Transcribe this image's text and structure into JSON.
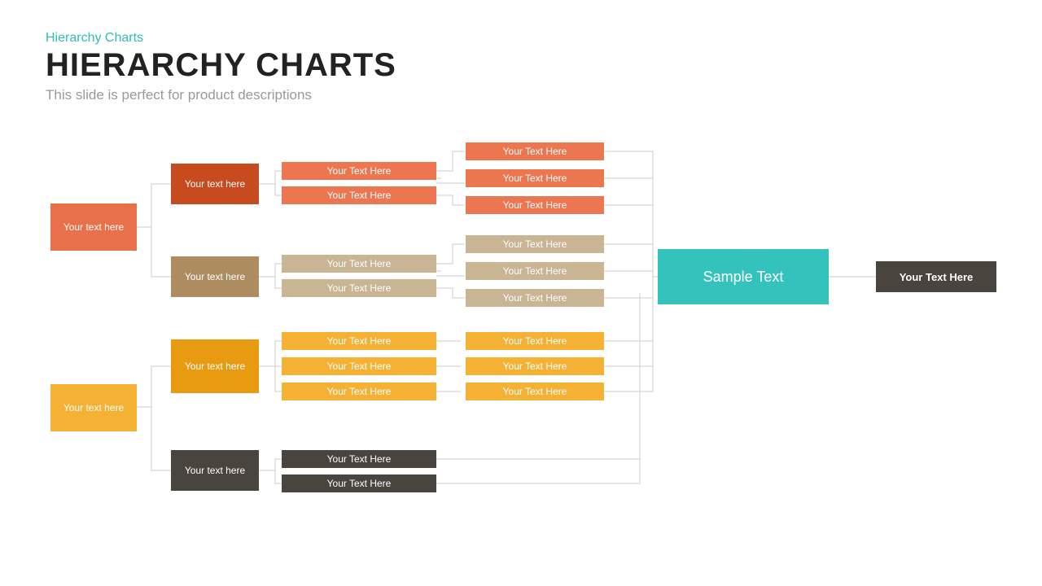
{
  "pretitle": "Hierarchy Charts",
  "title": "HIERARCHY CHARTS",
  "subtitle": "This slide is perfect for product descriptions",
  "root1": "Your text here",
  "root2": "Your text here",
  "g1": {
    "head": "Your text here",
    "items": [
      "Your Text Here",
      "Your Text Here"
    ],
    "leaves": [
      "Your Text Here",
      "Your Text Here",
      "Your Text Here"
    ]
  },
  "g2": {
    "head": "Your text here",
    "items": [
      "Your Text Here",
      "Your Text Here"
    ],
    "leaves": [
      "Your Text Here",
      "Your Text Here",
      "Your Text Here"
    ]
  },
  "g3": {
    "head": "Your text here",
    "items": [
      "Your Text Here",
      "Your Text Here",
      "Your Text Here"
    ],
    "leaves": [
      "Your Text Here",
      "Your Text Here",
      "Your Text Here"
    ]
  },
  "g4": {
    "head": "Your text here",
    "items": [
      "Your Text Here",
      "Your Text Here"
    ]
  },
  "sample": "Sample Text",
  "final": "Your Text Here"
}
